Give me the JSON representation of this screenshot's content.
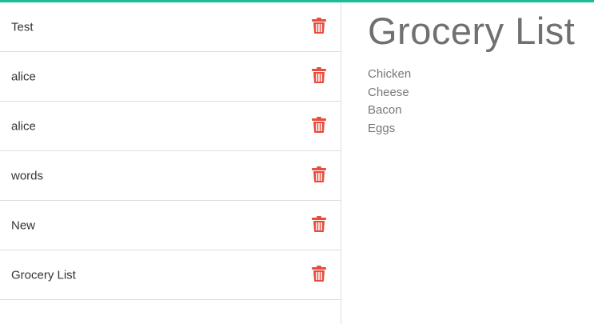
{
  "colors": {
    "accent": "#1abc9c",
    "trash": "#e74c3c",
    "title": "#707070",
    "text": "#333333",
    "muted": "#777777"
  },
  "sidebar": {
    "notes": [
      {
        "title": "Test",
        "delete_icon": "trash-icon"
      },
      {
        "title": "alice",
        "delete_icon": "trash-icon"
      },
      {
        "title": "alice",
        "delete_icon": "trash-icon"
      },
      {
        "title": "words",
        "delete_icon": "trash-icon"
      },
      {
        "title": "New",
        "delete_icon": "trash-icon"
      },
      {
        "title": "Grocery List",
        "delete_icon": "trash-icon"
      }
    ]
  },
  "main": {
    "title": "Grocery List",
    "lines": [
      "Chicken",
      "Cheese",
      "Bacon",
      "Eggs"
    ]
  }
}
